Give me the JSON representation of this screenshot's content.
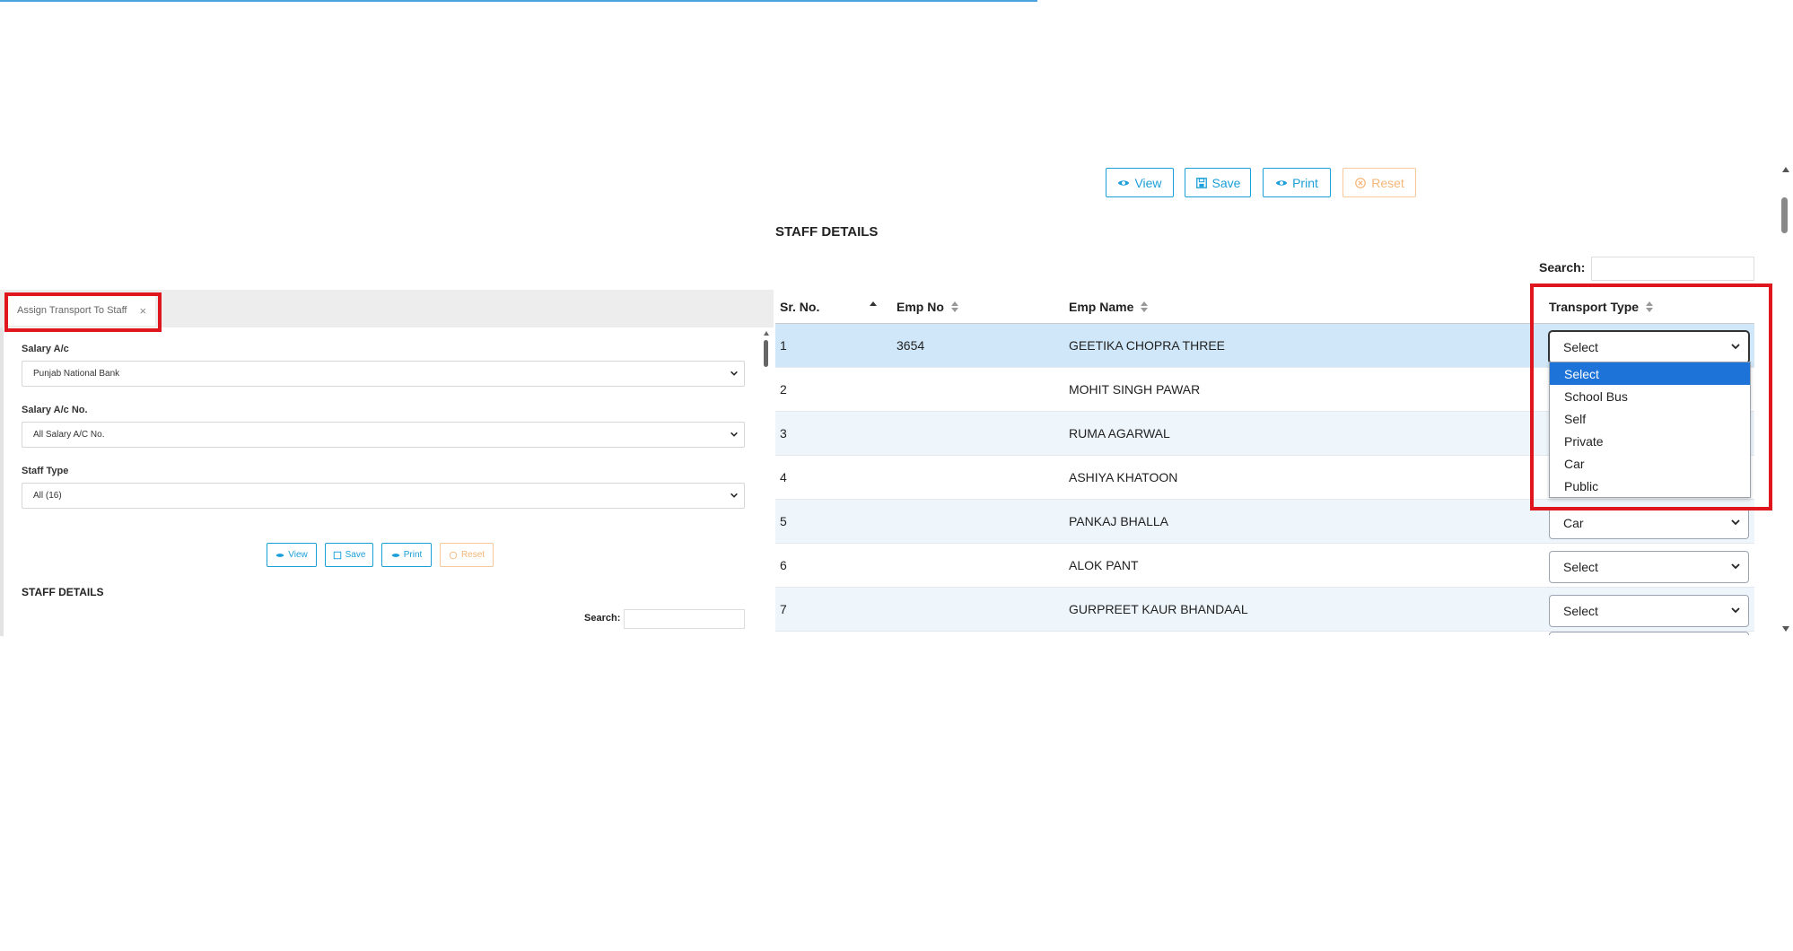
{
  "toolbar": {
    "view_label": "View",
    "save_label": "Save",
    "print_label": "Print",
    "reset_label": "Reset"
  },
  "section_title": "STAFF DETAILS",
  "search": {
    "label": "Search:",
    "value": ""
  },
  "table": {
    "headers": {
      "sr_no": "Sr. No.",
      "emp_no": "Emp No",
      "emp_name": "Emp Name",
      "transport_type": "Transport Type"
    },
    "rows": [
      {
        "sr": "1",
        "emp_no": "3654",
        "name": "GEETIKA CHOPRA THREE",
        "transport": "Select"
      },
      {
        "sr": "2",
        "emp_no": "",
        "name": "MOHIT SINGH PAWAR",
        "transport": ""
      },
      {
        "sr": "3",
        "emp_no": "",
        "name": "RUMA AGARWAL",
        "transport": ""
      },
      {
        "sr": "4",
        "emp_no": "",
        "name": "ASHIYA KHATOON",
        "transport": ""
      },
      {
        "sr": "5",
        "emp_no": "",
        "name": "PANKAJ BHALLA",
        "transport": "Car"
      },
      {
        "sr": "6",
        "emp_no": "",
        "name": "ALOK PANT",
        "transport": "Select"
      },
      {
        "sr": "7",
        "emp_no": "",
        "name": "GURPREET KAUR BHANDAAL",
        "transport": "Select"
      }
    ]
  },
  "transport_dropdown": {
    "options": [
      "Select",
      "School Bus",
      "Self",
      "Private",
      "Car",
      "Public"
    ],
    "highlighted": "Select"
  },
  "mini_panel": {
    "tab_label": "Assign Transport To Staff",
    "salary_ac_label": "Salary A/c",
    "salary_ac_value": "Punjab National Bank",
    "salary_ac_no_label": "Salary A/c No.",
    "salary_ac_no_value": "All Salary A/C No.",
    "staff_type_label": "Staff Type",
    "staff_type_value": "All (16)",
    "buttons": {
      "view": "View",
      "save": "Save",
      "print": "Print",
      "reset": "Reset"
    },
    "title": "STAFF DETAILS",
    "search_label": "Search:"
  },
  "colors": {
    "accent": "#1a9fd8",
    "reset": "#f5b678",
    "highlight_box": "#e0161e",
    "selected_row": "#cfe7f8",
    "dropdown_highlight": "#1e73d9"
  }
}
